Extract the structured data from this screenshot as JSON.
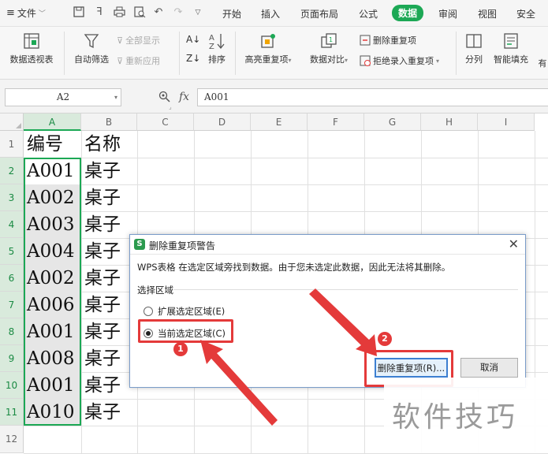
{
  "menubar": {
    "file_label": "文件",
    "tabs": [
      {
        "label": "开始",
        "active": false
      },
      {
        "label": "插入",
        "active": false
      },
      {
        "label": "页面布局",
        "active": false
      },
      {
        "label": "公式",
        "active": false
      },
      {
        "label": "数据",
        "active": true
      },
      {
        "label": "审阅",
        "active": false
      },
      {
        "label": "视图",
        "active": false
      },
      {
        "label": "安全",
        "active": false
      }
    ],
    "accent_color": "#1ca855"
  },
  "ribbon": {
    "pivot": "数据透视表",
    "autofilter": "自动筛选",
    "show_all": "全部显示",
    "reapply": "重新应用",
    "sort": "排序",
    "highlight_dup": "高亮重复项",
    "data_compare": "数据对比",
    "remove_dup": "删除重复项",
    "reject_dup": "拒绝录入重复项",
    "split_col": "分列",
    "smart_fill": "智能填充",
    "more": "有"
  },
  "formula_bar": {
    "name_box": "A2",
    "fx": "fx",
    "value": "A001"
  },
  "sheet": {
    "columns": [
      "A",
      "B",
      "C",
      "D",
      "E",
      "F",
      "G",
      "H",
      "I"
    ],
    "rows": [
      "1",
      "2",
      "3",
      "4",
      "5",
      "6",
      "7",
      "8",
      "9",
      "10",
      "11",
      "12"
    ],
    "col_a": [
      "编号",
      "A001",
      "A002",
      "A003",
      "A004",
      "A002",
      "A006",
      "A001",
      "A008",
      "A001",
      "A010"
    ],
    "col_b": [
      "名称",
      "桌子",
      "桌子",
      "桌子",
      "桌子",
      "桌子",
      "桌子",
      "桌子",
      "桌子",
      "桌子",
      "桌子"
    ]
  },
  "dialog": {
    "title": "删除重复项警告",
    "message": "WPS表格 在选定区域旁找到数据。由于您未选定此数据，因此无法将其删除。",
    "group_label": "选择区域",
    "option_expand": "扩展选定区域(E)",
    "option_current": "当前选定区域(C)",
    "selected_option": "current",
    "btn_remove": "删除重复项(R)...",
    "btn_cancel": "取消"
  },
  "annotations": {
    "badge1": "1",
    "badge2": "2",
    "color": "#e43a3a"
  },
  "watermark": "软件技巧"
}
